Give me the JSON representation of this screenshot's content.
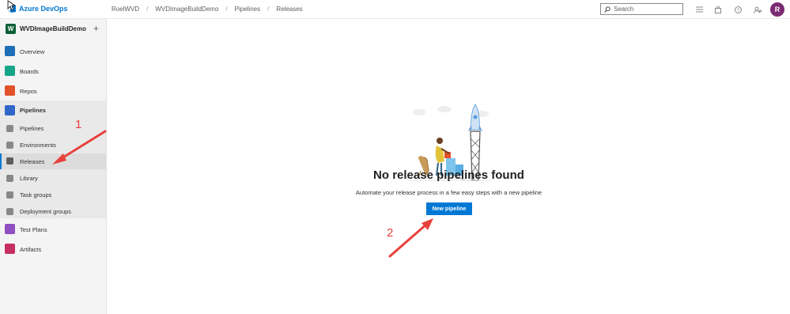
{
  "header": {
    "brand": "Azure DevOps",
    "breadcrumb": [
      "RoelWVD",
      "WVDImageBuildDemo",
      "Pipelines",
      "Releases"
    ],
    "search_placeholder": "Search",
    "icons": [
      "list-icon",
      "shopping-bag-icon",
      "help-icon",
      "user-settings-icon"
    ],
    "user_initial": "R"
  },
  "sidebar": {
    "project_initial": "W",
    "project_name": "WVDImageBuildDemo",
    "add_label": "+",
    "items": [
      {
        "label": "Overview"
      },
      {
        "label": "Boards"
      },
      {
        "label": "Repos"
      },
      {
        "label": "Pipelines"
      },
      {
        "label": "Pipelines"
      },
      {
        "label": "Environments"
      },
      {
        "label": "Releases"
      },
      {
        "label": "Library"
      },
      {
        "label": "Task groups"
      },
      {
        "label": "Deployment groups"
      },
      {
        "label": "Test Plans"
      },
      {
        "label": "Artifacts"
      }
    ],
    "selected": "Releases"
  },
  "main": {
    "empty_title": "No release pipelines found",
    "empty_description": "Automate your release process in a few easy steps with a new pipeline",
    "new_pipeline_label": "New pipeline"
  },
  "annotations": {
    "one": "1",
    "two": "2",
    "color": "#e8413c"
  },
  "colors": {
    "accent": "#0078d4",
    "avatar": "#7a2a72",
    "project_badge": "#0b5e37"
  }
}
